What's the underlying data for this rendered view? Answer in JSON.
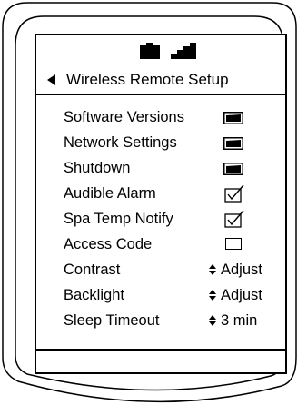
{
  "header": {
    "title": "Wireless Remote Setup",
    "icons": [
      "battery-icon",
      "signal-strength-icon"
    ]
  },
  "menu": {
    "items": [
      {
        "label": "Software Versions",
        "control": "folder-icon"
      },
      {
        "label": "Network Settings",
        "control": "folder-icon"
      },
      {
        "label": "Shutdown",
        "control": "folder-icon"
      },
      {
        "label": "Audible Alarm",
        "control": "checkbox",
        "checked": true
      },
      {
        "label": "Spa Temp Notify",
        "control": "checkbox",
        "checked": true
      },
      {
        "label": "Access Code",
        "control": "empty-box"
      },
      {
        "label": "Contrast",
        "control": "adjuster",
        "value": "Adjust"
      },
      {
        "label": "Backlight",
        "control": "adjuster",
        "value": "Adjust"
      },
      {
        "label": "Sleep Timeout",
        "control": "adjuster",
        "value": "3 min"
      }
    ]
  },
  "colors": {
    "foreground": "#000000",
    "background": "#ffffff"
  }
}
